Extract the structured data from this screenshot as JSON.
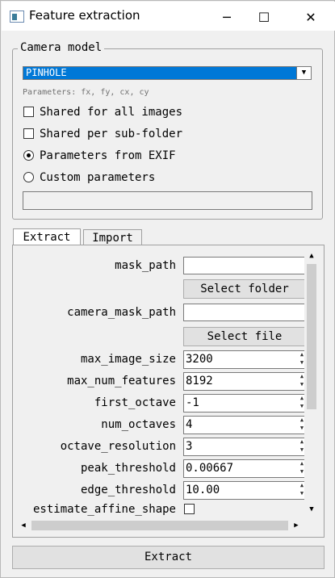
{
  "window": {
    "title": "Feature extraction",
    "app_icon": "window-app-icon",
    "controls": {
      "minimize": "─",
      "maximize": "☐",
      "close": "✕"
    }
  },
  "camera_model": {
    "legend": "Camera model",
    "selected": "PINHOLE",
    "dropdown_arrow": "▼",
    "parameters_hint": "Parameters: fx, fy, cx, cy",
    "options": [
      {
        "label": "Shared for all images",
        "type": "checkbox",
        "checked": false
      },
      {
        "label": "Shared per sub-folder",
        "type": "checkbox",
        "checked": false
      },
      {
        "label": "Parameters from EXIF",
        "type": "radio",
        "checked": true
      },
      {
        "label": "Custom parameters",
        "type": "radio",
        "checked": false
      }
    ],
    "custom_params_value": ""
  },
  "tabs": [
    {
      "label": "Extract",
      "active": true
    },
    {
      "label": "Import",
      "active": false
    }
  ],
  "params": {
    "mask_path": {
      "label": "mask_path",
      "value": "",
      "button": "Select folder"
    },
    "camera_mask_path": {
      "label": "camera_mask_path",
      "value": "",
      "button": "Select file"
    },
    "max_image_size": {
      "label": "max_image_size",
      "value": "3200"
    },
    "max_num_features": {
      "label": "max_num_features",
      "value": "8192"
    },
    "first_octave": {
      "label": "first_octave",
      "value": "-1"
    },
    "num_octaves": {
      "label": "num_octaves",
      "value": "4"
    },
    "octave_resolution": {
      "label": "octave_resolution",
      "value": "3"
    },
    "peak_threshold": {
      "label": "peak_threshold",
      "value": "0.00667"
    },
    "edge_threshold": {
      "label": "edge_threshold",
      "value": "10.00"
    },
    "estimate_affine_shape": {
      "label": "estimate_affine_shape",
      "checked": false
    }
  },
  "scrollbar": {
    "up": "▲",
    "down": "▼",
    "left": "◀",
    "right": "▶"
  },
  "spinner": {
    "up": "▲",
    "down": "▼"
  },
  "footer": {
    "extract_button": "Extract"
  }
}
